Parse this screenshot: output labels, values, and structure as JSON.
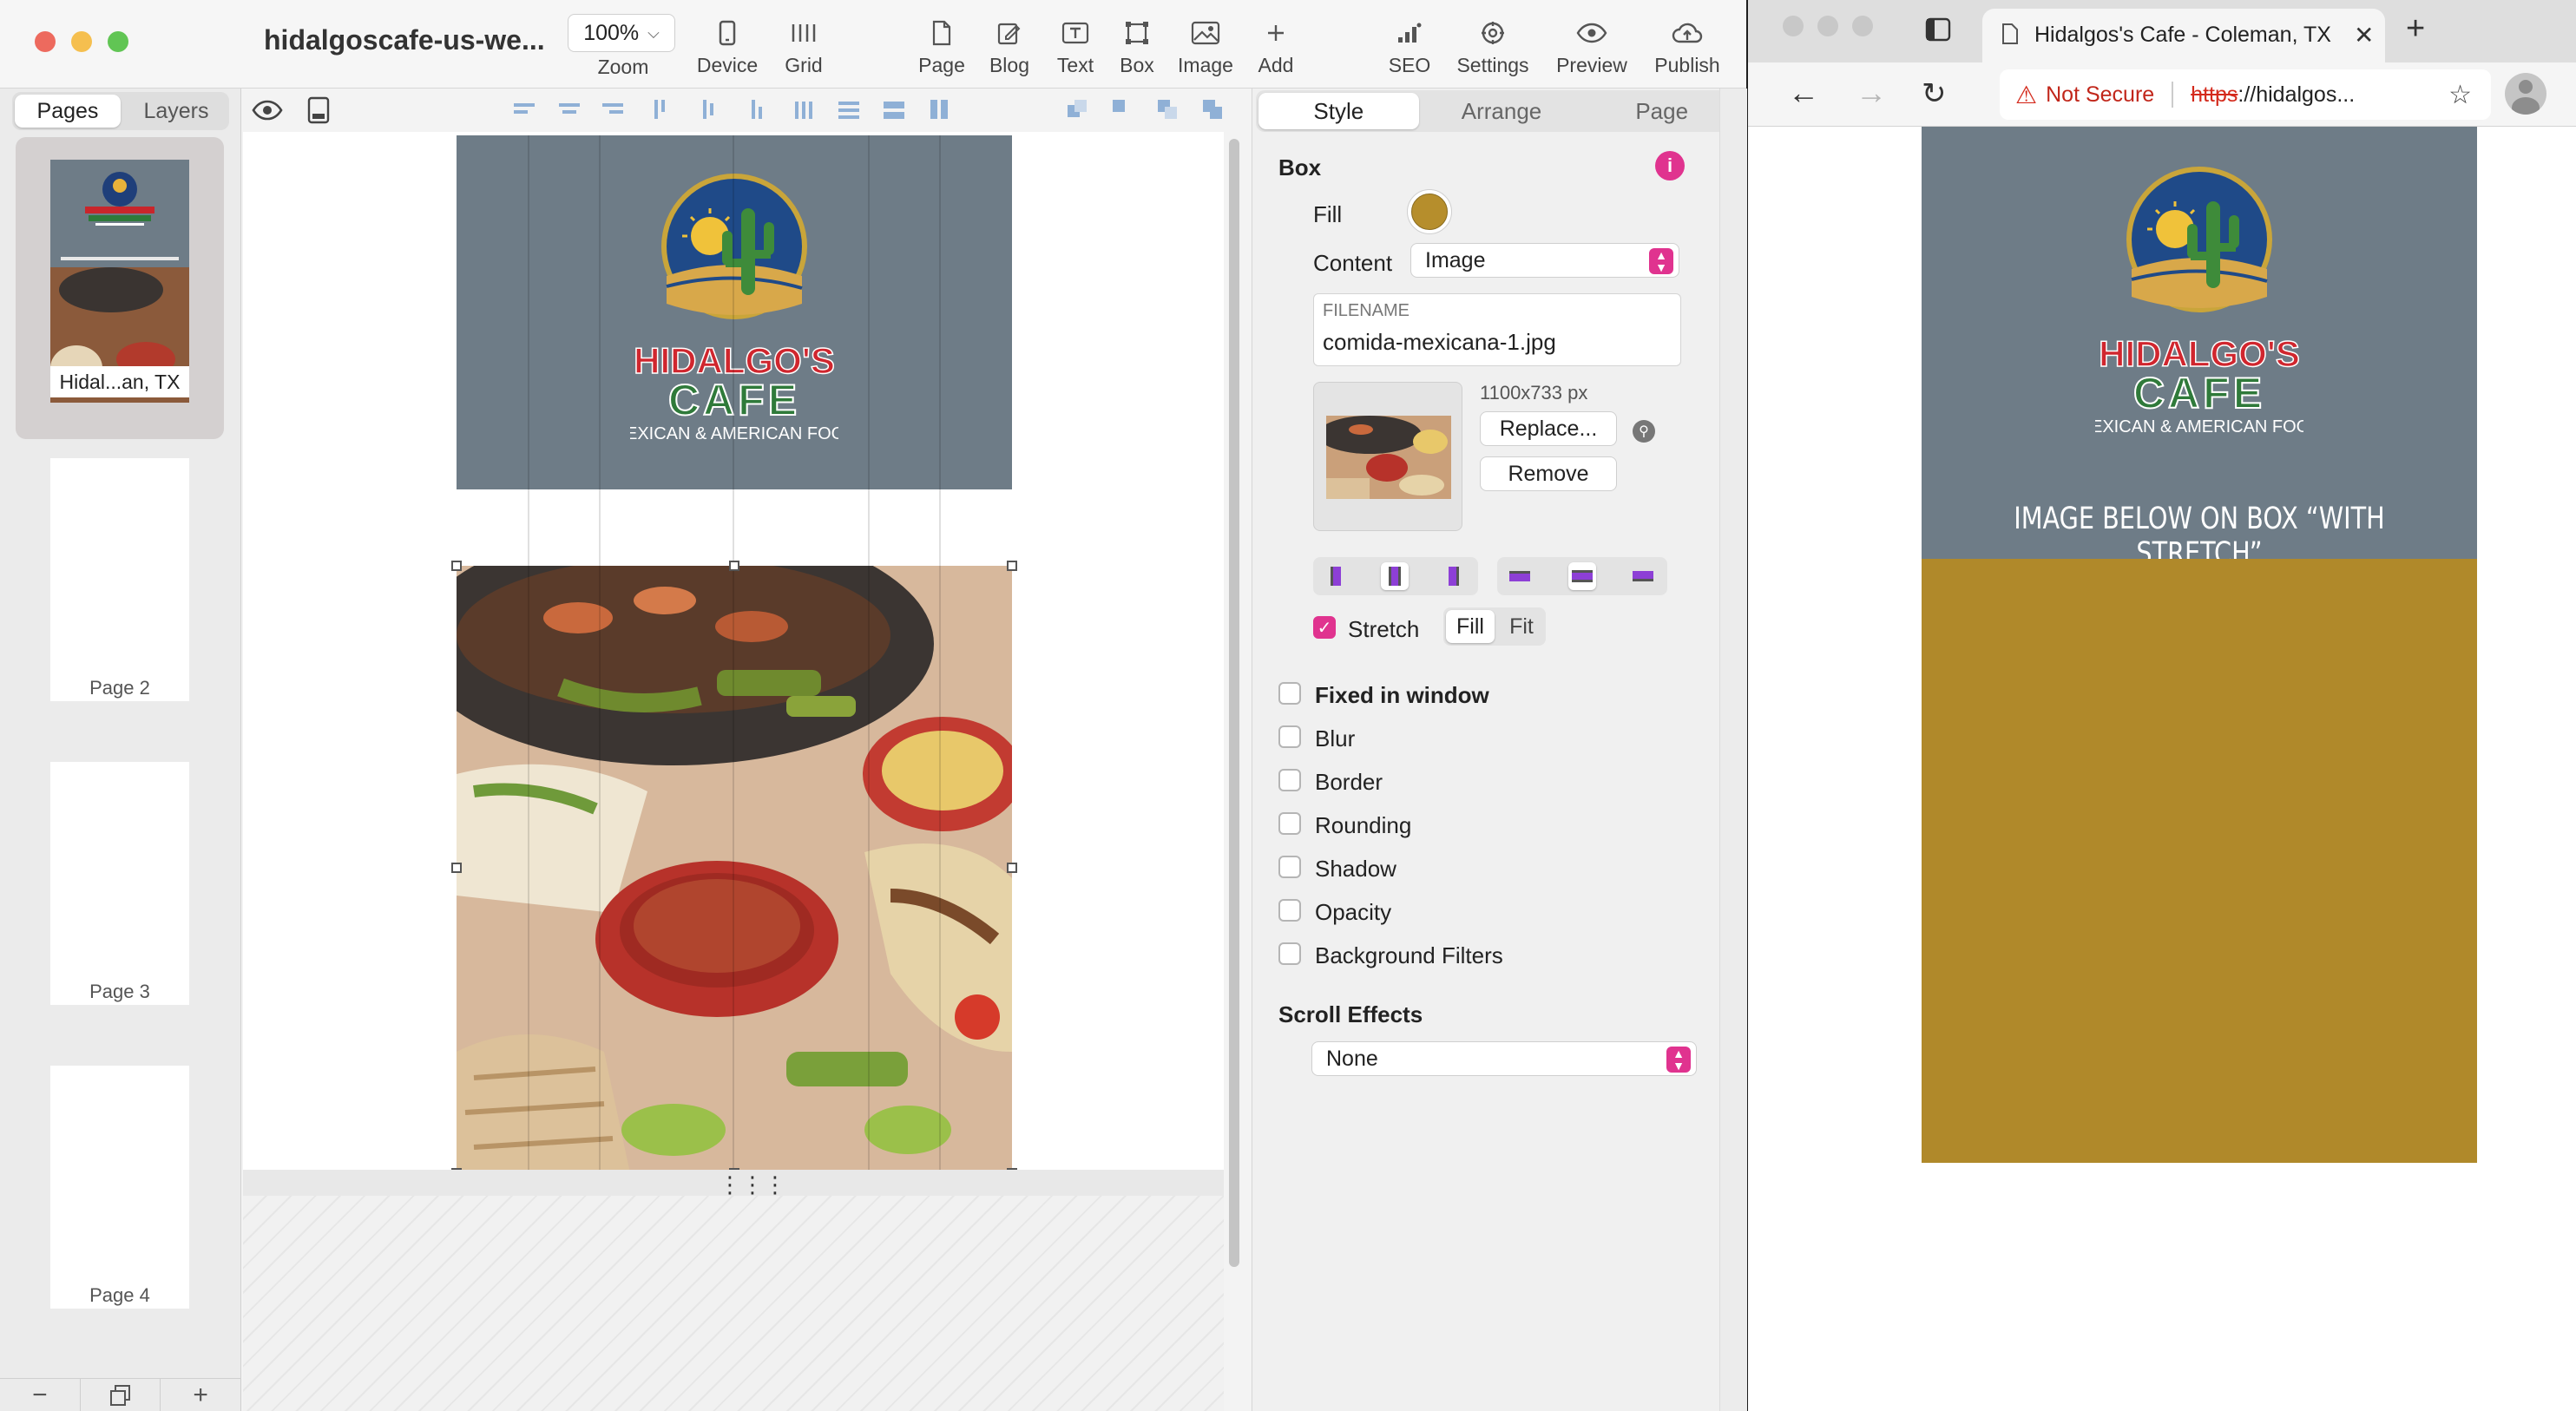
{
  "editor": {
    "title": "hidalgoscafe-us-we...",
    "zoom": {
      "value": "100%",
      "label": "Zoom"
    },
    "toolbar": {
      "device": "Device",
      "grid": "Grid",
      "page": "Page",
      "blog": "Blog",
      "text": "Text",
      "box": "Box",
      "image": "Image",
      "add": "Add",
      "seo": "SEO",
      "settings": "Settings",
      "preview": "Preview",
      "publish": "Publish"
    },
    "left_tabs": {
      "pages": "Pages",
      "layers": "Layers"
    },
    "pages": [
      {
        "label": "Hidal...an, TX",
        "selected": true
      },
      {
        "label": "Page 2",
        "selected": false
      },
      {
        "label": "Page 3",
        "selected": false
      },
      {
        "label": "Page 4",
        "selected": false
      }
    ],
    "canvas": {
      "logo": {
        "line1": "HIDALGO'S",
        "line2": "CAFE",
        "line3": "MEXICAN & AMERICAN FOOD"
      },
      "caption": "IMAGE BELOW ON BOX “WITH STRETCH”",
      "header_color": "#6e7c87"
    }
  },
  "inspector": {
    "tabs": {
      "style": "Style",
      "arrange": "Arrange",
      "page": "Page"
    },
    "section_title": "Box",
    "fill_label": "Fill",
    "fill_color": "#b68e2c",
    "content_label": "Content",
    "content_value": "Image",
    "filename_label": "FILENAME",
    "filename_value": "comida-mexicana-1.jpg",
    "image_size": "1100x733 px",
    "replace_label": "Replace...",
    "remove_label": "Remove",
    "stretch_label": "Stretch",
    "stretch_checked": true,
    "fill_mode": "Fill",
    "fit_mode": "Fit",
    "options": [
      {
        "label": "Fixed in window",
        "checked": false,
        "bold": true
      },
      {
        "label": "Blur",
        "checked": false
      },
      {
        "label": "Border",
        "checked": false
      },
      {
        "label": "Rounding",
        "checked": false
      },
      {
        "label": "Shadow",
        "checked": false
      },
      {
        "label": "Opacity",
        "checked": false
      },
      {
        "label": "Background Filters",
        "checked": false
      }
    ],
    "scroll_effects_title": "Scroll Effects",
    "scroll_effects_value": "None",
    "accent_color": "#e0338f"
  },
  "browser": {
    "tab_title": "Hidalgos's Cafe - Coleman, TX",
    "not_secure": "Not Secure",
    "url_scheme": "https",
    "url_rest": "://hidalgos...",
    "caption": "IMAGE BELOW ON BOX “WITH STRETCH”",
    "fill_color": "#b0892a"
  }
}
